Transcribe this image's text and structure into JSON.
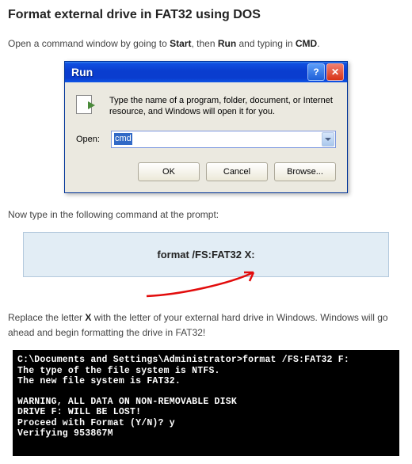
{
  "heading": "Format external drive in FAT32 using DOS",
  "p1_pre": "Open a command window by going to ",
  "p1_start": "Start",
  "p1_then": ", then ",
  "p1_run": "Run",
  "p1_and": " and typing in ",
  "p1_cmd": "CMD",
  "p1_end": ".",
  "run_dialog": {
    "title": "Run",
    "help": "?",
    "close": "✕",
    "desc": "Type the name of a program, folder, document, or Internet resource, and Windows will open it for you.",
    "open_label": "Open:",
    "open_value": "cmd",
    "ok": "OK",
    "cancel": "Cancel",
    "browse": "Browse..."
  },
  "p2": "Now type in the following command at the prompt:",
  "command": "format /FS:FAT32 X:",
  "p3_a": "Replace the letter ",
  "p3_x": "X",
  "p3_b": " with the letter of your external hard drive in Windows. Windows will go ahead and begin formatting the drive in FAT32!",
  "console_text": "C:\\Documents and Settings\\Administrator>format /FS:FAT32 F:\nThe type of the file system is NTFS.\nThe new file system is FAT32.\n\nWARNING, ALL DATA ON NON-REMOVABLE DISK\nDRIVE F: WILL BE LOST!\nProceed with Format (Y/N)? y\nVerifying 953867M"
}
